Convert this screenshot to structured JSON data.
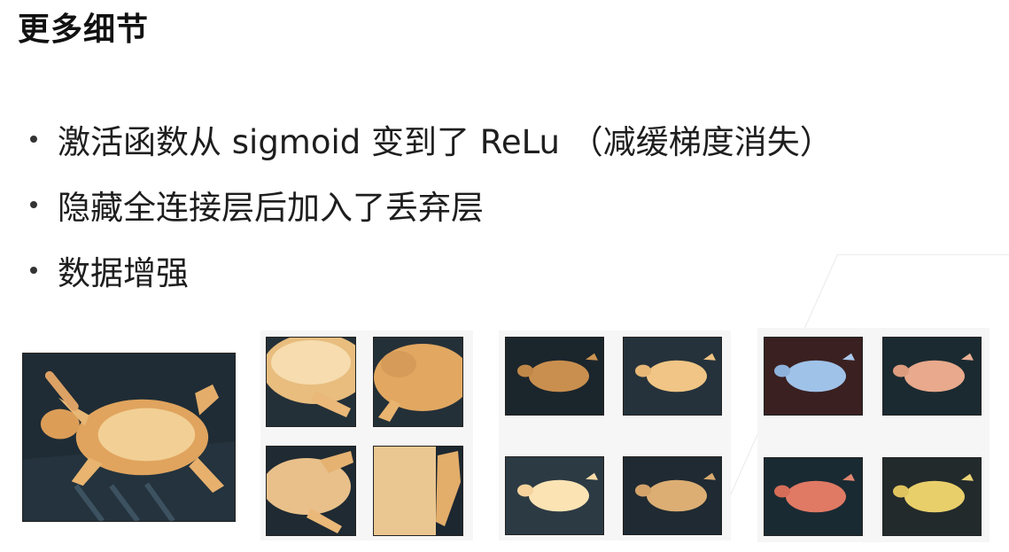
{
  "slide": {
    "title": "更多细节",
    "bullets": [
      "激活函数从 sigmoid 变到了 ReLu （减缓梯度消失）",
      "隐藏全连接层后加入了丢弃层",
      "数据增强"
    ]
  },
  "images": {
    "original": {
      "subject": "cat"
    },
    "crops": [
      {
        "kind": "crop",
        "variant": "top-left-zoom"
      },
      {
        "kind": "crop",
        "variant": "head-zoom"
      },
      {
        "kind": "crop",
        "variant": "legs-zoom"
      },
      {
        "kind": "crop",
        "variant": "tail-zoom"
      }
    ],
    "brightness": [
      {
        "kind": "brightness",
        "variant": "darker"
      },
      {
        "kind": "brightness",
        "variant": "bright"
      },
      {
        "kind": "brightness",
        "variant": "brighter"
      },
      {
        "kind": "brightness",
        "variant": "dim"
      }
    ],
    "color": [
      {
        "kind": "color",
        "variant": "blue-tint",
        "tint": "#9fc2e8"
      },
      {
        "kind": "color",
        "variant": "peach-tint",
        "tint": "#e8a98c"
      },
      {
        "kind": "color",
        "variant": "red-tint",
        "tint": "#e07a64"
      },
      {
        "kind": "color",
        "variant": "yellow-tint",
        "tint": "#e9cf6a"
      }
    ]
  }
}
